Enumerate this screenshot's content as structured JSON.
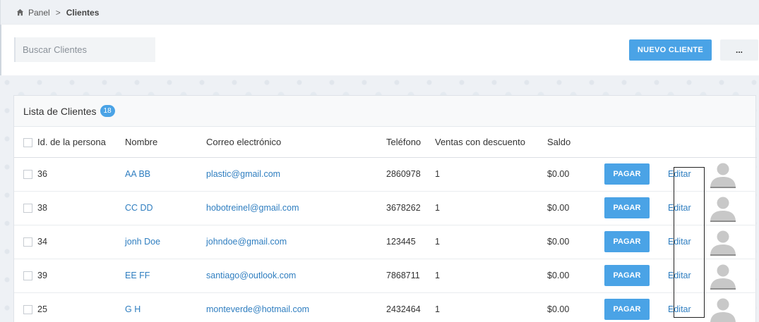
{
  "breadcrumb": {
    "home": "Panel",
    "current": "Clientes"
  },
  "toolbar": {
    "search_placeholder": "Buscar Clientes",
    "new_client_label": "NUEVO CLIENTE",
    "more_label": "..."
  },
  "card": {
    "title": "Lista de Clientes",
    "count": "18"
  },
  "table": {
    "headers": {
      "id": "Id. de la persona",
      "name": "Nombre",
      "email": "Correo electrónico",
      "phone": "Teléfono",
      "discount_sales": "Ventas con descuento",
      "balance": "Saldo"
    },
    "rows": [
      {
        "id": "36",
        "name": "AA BB",
        "email": "plastic@gmail.com",
        "phone": "2860978",
        "discount_sales": "1",
        "balance": "$0.00",
        "pay": "PAGAR",
        "edit": "Editar"
      },
      {
        "id": "38",
        "name": "CC DD",
        "email": "hobotreinel@gmail.com",
        "phone": "3678262",
        "discount_sales": "1",
        "balance": "$0.00",
        "pay": "PAGAR",
        "edit": "Editar"
      },
      {
        "id": "34",
        "name": "jonh Doe",
        "email": "johndoe@gmail.com",
        "phone": "123445",
        "discount_sales": "1",
        "balance": "$0.00",
        "pay": "PAGAR",
        "edit": "Editar"
      },
      {
        "id": "39",
        "name": "EE FF",
        "email": "santiago@outlook.com",
        "phone": "7868711",
        "discount_sales": "1",
        "balance": "$0.00",
        "pay": "PAGAR",
        "edit": "Editar"
      },
      {
        "id": "25",
        "name": "G H",
        "email": "monteverde@hotmail.com",
        "phone": "2432464",
        "discount_sales": "1",
        "balance": "$0.00",
        "pay": "PAGAR",
        "edit": "Editar"
      }
    ]
  },
  "colors": {
    "accent": "#4aa3e6",
    "link": "#2f7ec0"
  },
  "icons": {
    "breadcrumb_home": "home-icon",
    "row_avatar": "avatar-placeholder-icon"
  }
}
